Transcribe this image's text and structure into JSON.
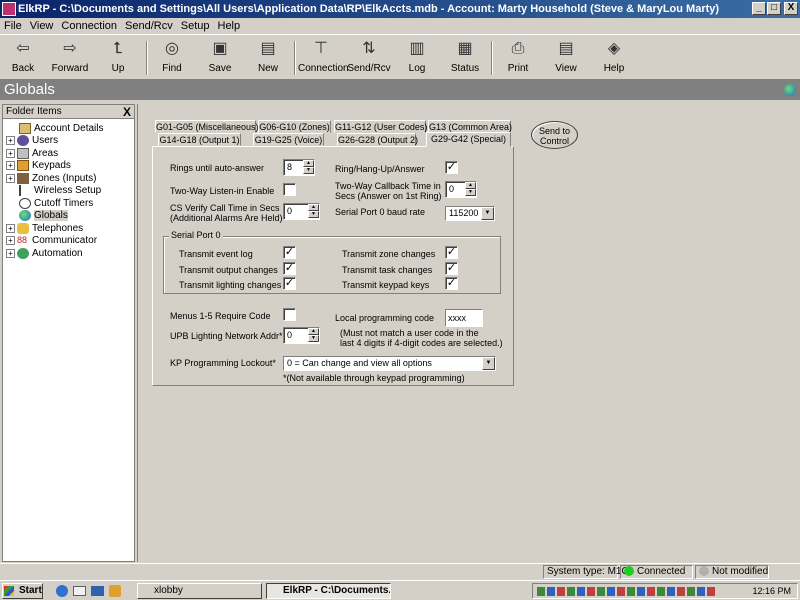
{
  "window": {
    "title": "ElkRP - C:\\Documents and Settings\\All Users\\Application Data\\RP\\ElkAccts.mdb - Account: Marty Household (Steve & MaryLou Marty)",
    "min": "_",
    "max": "□",
    "close": "X"
  },
  "menu": [
    "File",
    "View",
    "Connection",
    "Send/Rcv",
    "Setup",
    "Help"
  ],
  "toolbar": {
    "back": "Back",
    "forward": "Forward",
    "up": "Up",
    "find": "Find",
    "save": "Save",
    "new": "New",
    "connection": "Connection",
    "sendrcv": "Send/Rcv",
    "log": "Log",
    "status": "Status",
    "print": "Print",
    "view": "View",
    "help": "Help"
  },
  "header": {
    "title": "Globals"
  },
  "folder": {
    "title": "Folder Items",
    "close": "X",
    "items": [
      "Account Details",
      "Users",
      "Areas",
      "Keypads",
      "Zones (Inputs)",
      "Wireless Setup",
      "Cutoff Timers",
      "Globals",
      "Telephones",
      "Communicator",
      "Automation"
    ]
  },
  "tabs": {
    "row1": [
      "G01-G05 (Miscellaneous)",
      "G06-G10 (Zones)",
      "G11-G12 (User Codes)",
      "G13 (Common Area)"
    ],
    "row2": [
      "G14-G18 (Output 1)",
      "G19-G25 (Voice)",
      "G26-G28 (Output 2)",
      "G29-G42 (Special)"
    ]
  },
  "send_to_control": {
    "line1": "Send to",
    "line2": "Control"
  },
  "form": {
    "rings_label": "Rings until auto-answer",
    "rings_value": "8",
    "ring_hang_label": "Ring/Hang-Up/Answer",
    "ring_hang_checked": true,
    "twoway_listen_label": "Two-Way Listen-in Enable",
    "twoway_listen_checked": false,
    "twoway_callback_label1": "Two-Way Callback Time in",
    "twoway_callback_label2": "Secs (Answer on 1st Ring)",
    "twoway_callback_value": "0",
    "cs_verify_label1": "CS Verify Call Time in Secs",
    "cs_verify_label2": "(Additional Alarms Are Held)",
    "cs_verify_value": "0",
    "serial_baud_label": "Serial Port 0 baud rate",
    "serial_baud_value": "115200",
    "serial_group_label": "Serial Port 0",
    "transmit": [
      {
        "label": "Transmit event log",
        "checked": true
      },
      {
        "label": "Transmit zone changes",
        "checked": true
      },
      {
        "label": "Transmit output changes",
        "checked": true
      },
      {
        "label": "Transmit task changes",
        "checked": true
      },
      {
        "label": "Transmit lighting changes",
        "checked": true
      },
      {
        "label": "Transmit keypad keys",
        "checked": true
      }
    ],
    "menus_label": "Menus 1-5 Require Code",
    "menus_checked": false,
    "local_prog_label": "Local programming code",
    "local_prog_value": "xxxx",
    "local_note1": "(Must not match a user code in the",
    "local_note2": "last 4 digits if 4-digit codes are selected.)",
    "upb_label": "UPB Lighting Network Addr*",
    "upb_value": "0",
    "kp_lockout_label": "KP Programming Lockout*",
    "kp_lockout_value": "0 = Can change and view all options",
    "footnote": "*(Not available through keypad programming)"
  },
  "status": {
    "system_type": "System type: M1G",
    "connected": "Connected",
    "modified": "Not modified",
    "connected_color": "#22cc22",
    "modified_color": "#b0b0b0"
  },
  "taskbar": {
    "start": "Start",
    "task1": "xlobby",
    "task2": "ElkRP - C:\\Documents...",
    "clock": "12:16 PM"
  }
}
